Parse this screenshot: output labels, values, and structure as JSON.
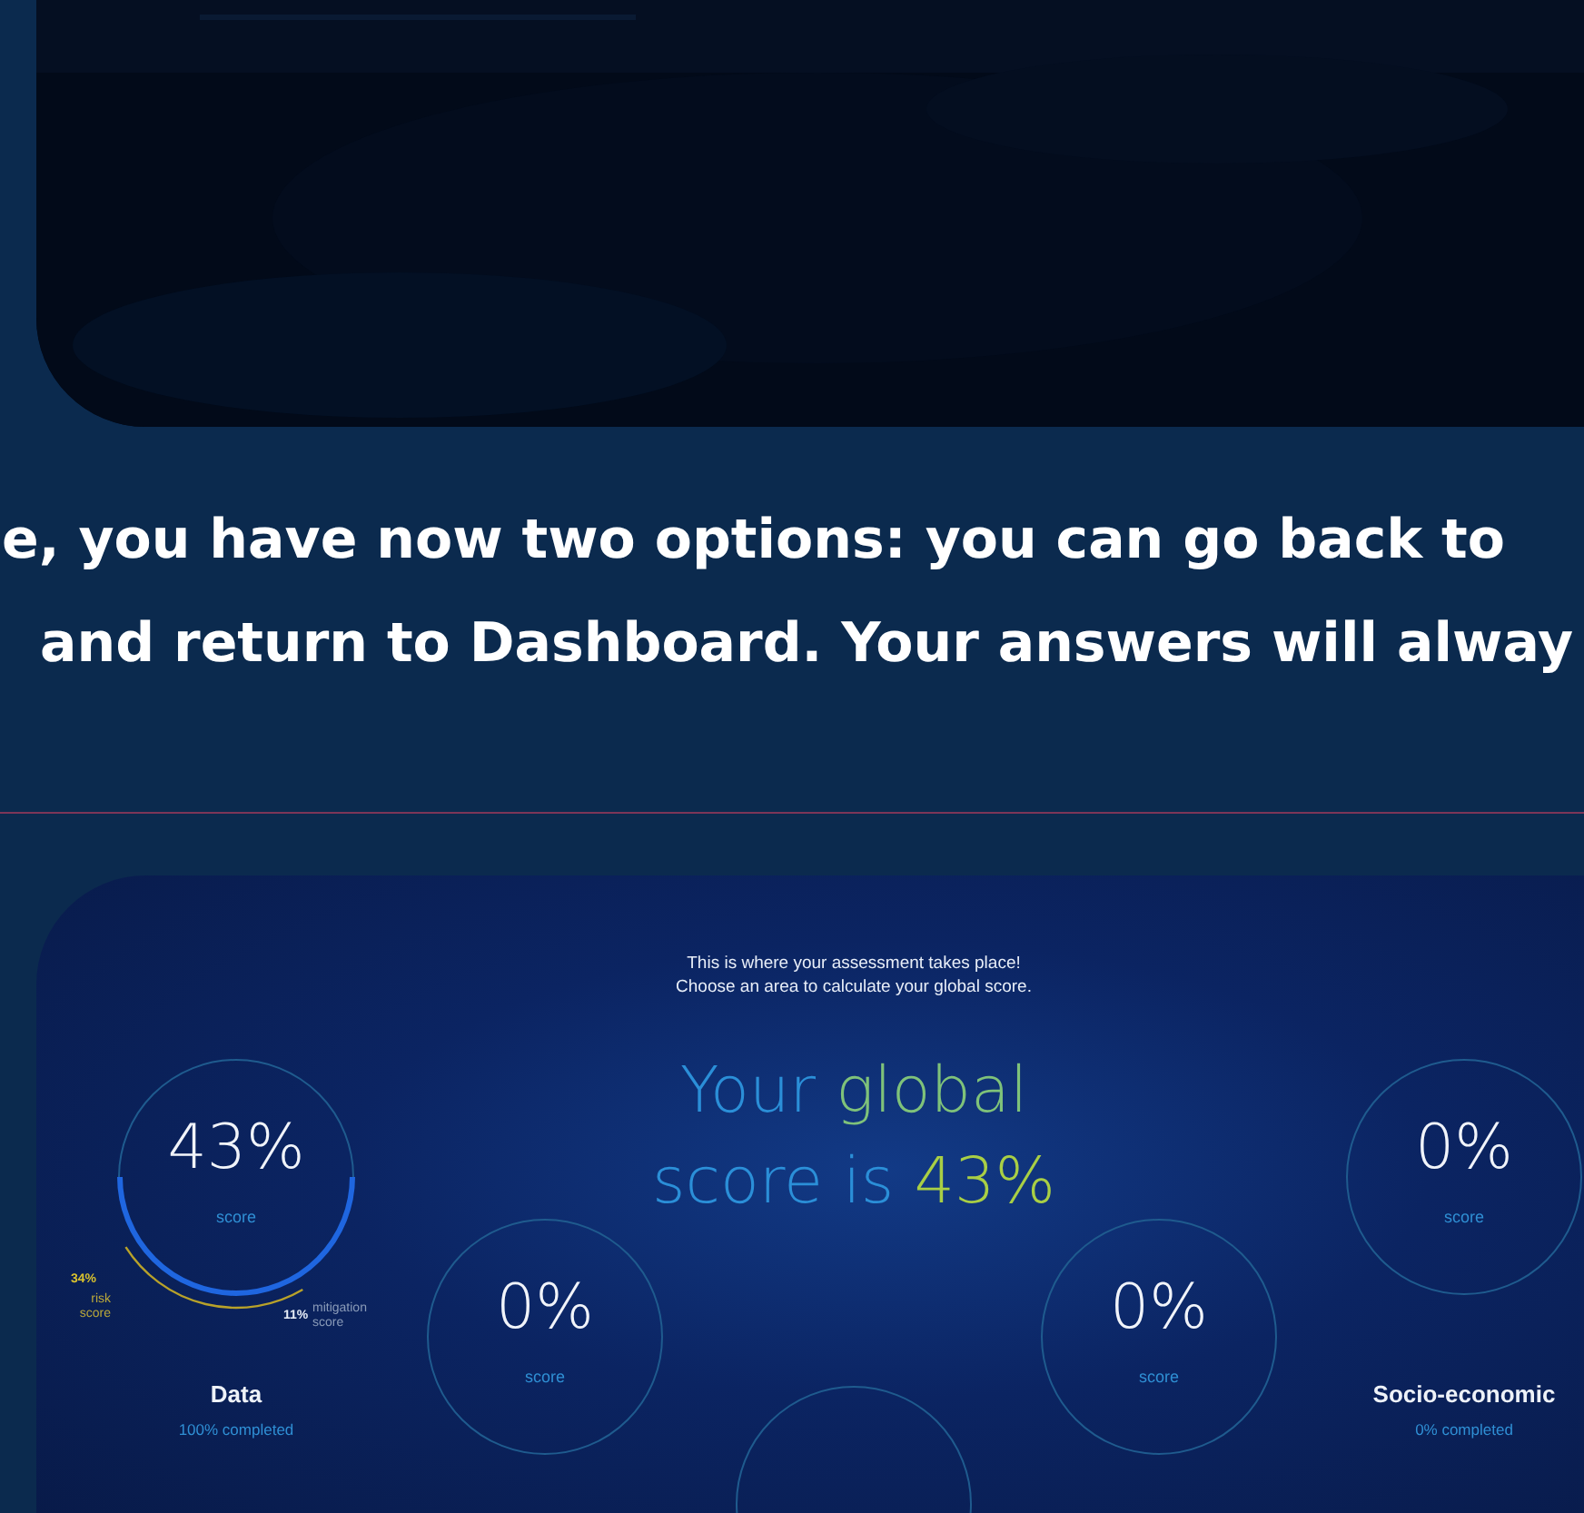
{
  "description": {
    "lines": [
      "e, you have now two options: you can go back to",
      "and return to Dashboard. Your answers will alway"
    ]
  },
  "screenshot": {
    "intro": [
      "This is where your assessment takes place!",
      "Choose an area to calculate your global score."
    ],
    "title_lines": [
      [
        {
          "text": "Your ",
          "color": "#2b8fd8"
        },
        {
          "text": "global",
          "color": "#7fc27a"
        }
      ],
      [
        {
          "text": "score is ",
          "color": "#2b8fd8"
        },
        {
          "text": "43%",
          "color": "#a9cf45"
        }
      ]
    ],
    "areas": [
      {
        "percent": "43%",
        "score_label": "score",
        "risk": {
          "value": "34%",
          "label": "risk score"
        },
        "mitigation": {
          "value": "11%",
          "label": "mitigation score"
        },
        "name": "Data",
        "completed": "100% completed"
      },
      {
        "percent": "0%",
        "score_label": "score"
      },
      {
        "percent": "0%",
        "score_label": "score"
      },
      {
        "percent": "0%",
        "score_label": "score",
        "name": "Socio-economic",
        "completed": "0% completed"
      }
    ]
  }
}
